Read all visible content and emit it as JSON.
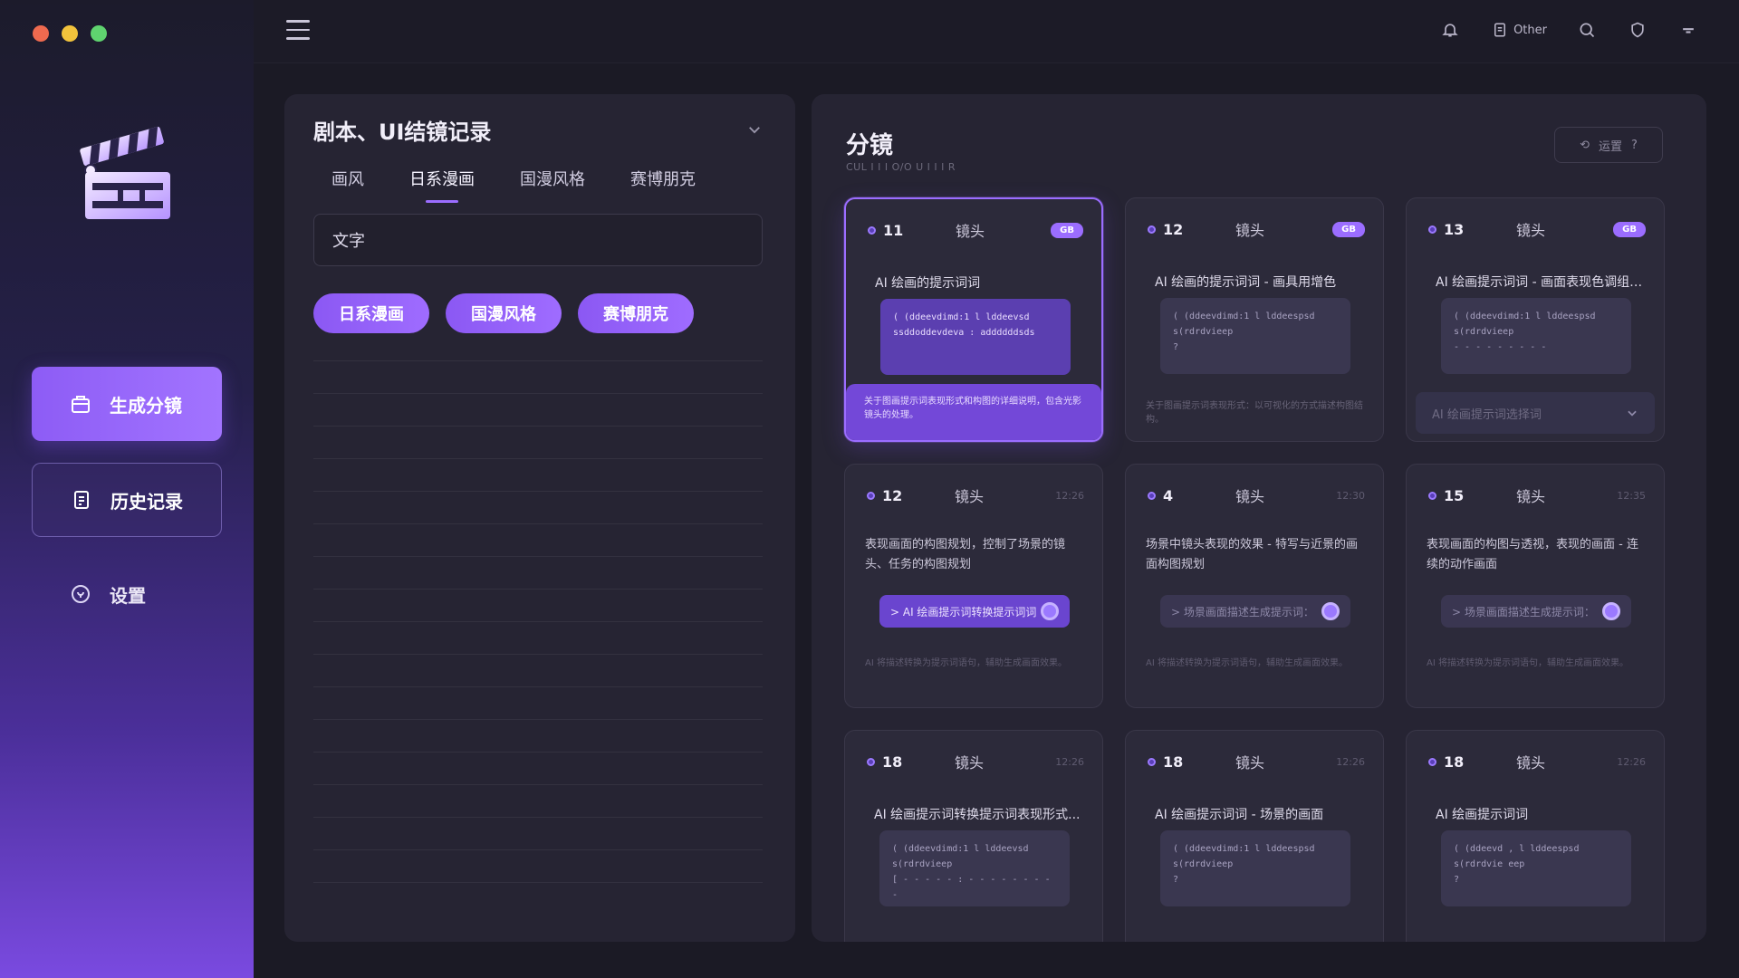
{
  "sidebar": {
    "nav": [
      {
        "label": "生成分镜",
        "icon": "briefcase-icon"
      },
      {
        "label": "历史记录",
        "icon": "document-icon"
      },
      {
        "label": "设置",
        "icon": "settings-icon"
      }
    ]
  },
  "topbar": {
    "other_label": "Other"
  },
  "left_panel": {
    "title": "剧本、UI结镜记录",
    "tabs": [
      "画风",
      "日系漫画",
      "国漫风格",
      "赛博朋克"
    ],
    "active_tab": 1,
    "input_value": "文字",
    "chips": [
      "日系漫画",
      "国漫风格",
      "赛博朋克"
    ]
  },
  "right_panel": {
    "title": "分镜",
    "subtitle": "CUL I I I O/O U  I I I R",
    "action_label": "运置",
    "lens_label": "镜头",
    "cards": [
      {
        "num": "11",
        "badge": "GB",
        "prompt": "AI 绘画的提示词词",
        "code": [
          "( (ddeevdimd:1 l lddeevsd",
          "ssddoddevdeva : addddddsds"
        ],
        "footer": "关于图画提示词表现形式和构图的详细说明，包含光影镜头的处理。",
        "selected": true
      },
      {
        "num": "12",
        "badge": "GB",
        "prompt": "AI 绘画的提示词词 - 画具用增色",
        "code": [
          "( (ddeevdimd:1 l lddeespsd",
          "s(rdrdvieep",
          "?"
        ],
        "desc": "关于图画提示词表现形式：以可视化的方式描述构图结构。"
      },
      {
        "num": "13",
        "badge": "GB",
        "prompt": "AI 绘画提示词词 - 画面表现色调组图...",
        "code": [
          "( (ddeevdimd:1 l lddeespsd",
          "s(rdrdvieep",
          "- - - - - - - - -"
        ],
        "select_label": "AI 绘画提示词选择词"
      },
      {
        "num": "12",
        "time": "12:26",
        "text": "表现画面的构图规划，控制了场景的镜头、任务的构图规划",
        "pill": "> AI 绘画提示词转换提示词词",
        "pill_active": true,
        "desc": "AI 将描述转换为提示词语句，辅助生成画面效果。"
      },
      {
        "num": "4",
        "time": "12:30",
        "text": "场景中镜头表现的效果 - 特写与近景的画面构图规划",
        "pill": "> 场景画面描述生成提示词：",
        "desc": "AI 将描述转换为提示词语句，辅助生成画面效果。"
      },
      {
        "num": "15",
        "time": "12:35",
        "text": "表现画面的构图与透视，表现的画面 - 连续的动作画面",
        "pill": "> 场景画面描述生成提示词：",
        "desc": "AI 将描述转换为提示词语句，辅助生成画面效果。"
      },
      {
        "num": "18",
        "time": "12:26",
        "prompt": "AI 绘画提示词转换提示词表现形式...",
        "code": [
          "( (ddeevdimd:1 l lddeevsd",
          "s(rdrdvieep",
          "[ - - - - - : - - - - - - - - -"
        ]
      },
      {
        "num": "18",
        "time": "12:26",
        "prompt": "AI 绘画提示词词 - 场景的画面",
        "code": [
          "( (ddeevdimd:1 l lddeespsd",
          "s(rdrdvieep",
          "?"
        ]
      },
      {
        "num": "18",
        "time": "12:26",
        "prompt": "AI 绘画提示词词",
        "code": [
          "( (ddeevd , l lddeespsd",
          "s(rdrdvie eep",
          "?"
        ]
      }
    ]
  },
  "colors": {
    "accent": "#9b6dff",
    "sidebar_bottom": "#7a4ae0",
    "panel_bg": "#262433"
  }
}
